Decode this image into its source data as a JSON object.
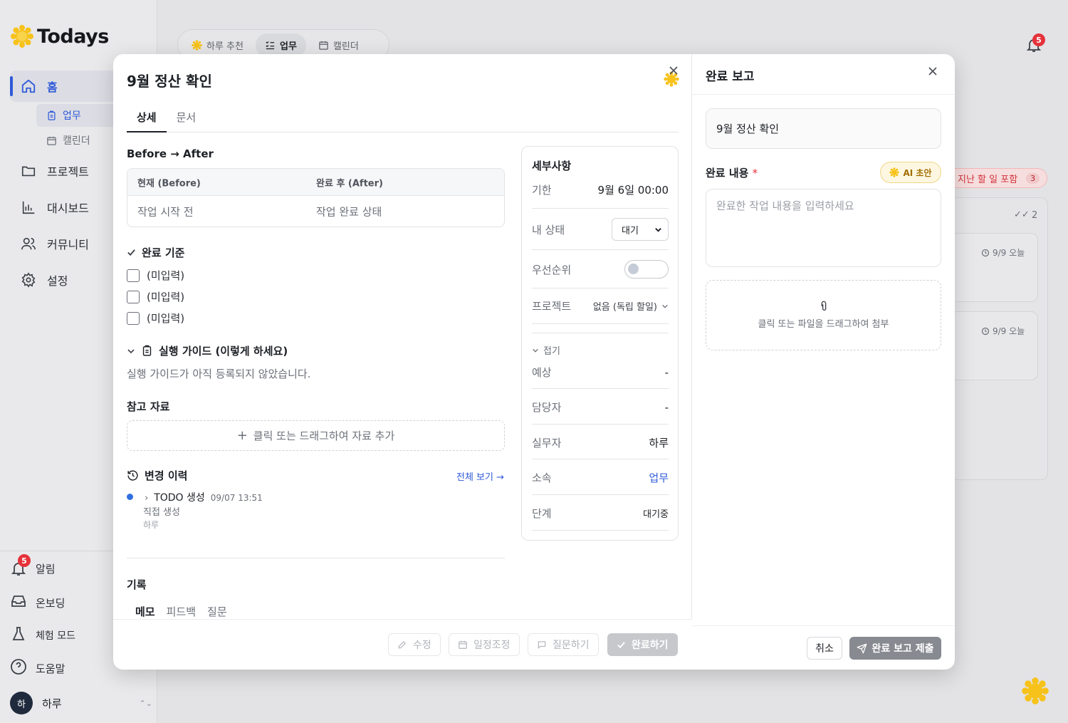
{
  "app": {
    "name": "Todays"
  },
  "sidebar": {
    "home": "홈",
    "sub": [
      "업무",
      "캘린더"
    ],
    "items": [
      "프로젝트",
      "대시보드",
      "커뮤니티",
      "설정"
    ],
    "bottom": [
      "알림",
      "온보딩",
      "체험 모드",
      "도움말"
    ],
    "alert_count": "5",
    "user_initial": "하",
    "user_name": "하루"
  },
  "topbar": {
    "tabs": [
      "하루 추천",
      "업무",
      "캘린더"
    ],
    "active_tab": "업무",
    "bell_count": "5"
  },
  "background": {
    "overdue_label": "지난 할 일 포함",
    "overdue_count": "3",
    "done_count": "2",
    "card_dates": [
      "9/9 오늘",
      "9/9 오늘"
    ]
  },
  "task": {
    "title": "9월 정산 확인",
    "tabs": [
      "상세",
      "문서"
    ],
    "before_after_title": "Before → After",
    "before_header": "현재 (Before)",
    "after_header": "완료 후 (After)",
    "before_value": "작업 시작 전",
    "after_value": "작업 완료 상태",
    "criteria_title": "완료 기준",
    "criteria": [
      "(미입력)",
      "(미입력)",
      "(미입력)"
    ],
    "guide_title": "실행 가이드 (이렇게 하세요)",
    "guide_empty": "실행 가이드가 아직 등록되지 않았습니다.",
    "reference_title": "참고 자료",
    "reference_drop": "클릭 또는 드래그하여 자료 추가",
    "history_title": "변경 이력",
    "history_view_all": "전체 보기 →",
    "history": {
      "action": "TODO 생성",
      "time": "09/07 13:51",
      "detail": "직접 생성",
      "actor": "하루"
    },
    "record_title": "기록",
    "record_tabs": [
      "메모",
      "피드백",
      "질문"
    ],
    "footer": {
      "edit": "수정",
      "reschedule": "일정조정",
      "ask": "질문하기",
      "complete": "완료하기"
    }
  },
  "details": {
    "title": "세부사항",
    "due_label": "기한",
    "due_value": "9월 6일 00:00",
    "status_label": "내 상태",
    "status_value": "대기",
    "priority_label": "우선순위",
    "priority_on": false,
    "project_label": "프로젝트",
    "project_value": "없음 (독립 할일)",
    "fold_label": "접기",
    "estimate_label": "예상",
    "estimate_value": "-",
    "owner_label": "담당자",
    "owner_value": "-",
    "worker_label": "실무자",
    "worker_value": "하루",
    "belong_label": "소속",
    "belong_value": "업무",
    "stage_label": "단계",
    "stage_value": "대기중"
  },
  "report": {
    "title": "완료 보고",
    "task_name": "9월 정산 확인",
    "content_label": "완료 내용",
    "required_mark": "*",
    "ai_button": "AI 초안",
    "placeholder": "완료한 작업 내용을 입력하세요",
    "attach_text": "클릭 또는 파일을 드래그하여 첨부",
    "cancel": "취소",
    "submit": "완료 보고 제출"
  },
  "colors": {
    "accent": "#2f5bd8",
    "brand_yellow": "#f7c21a",
    "danger": "#e5323b"
  }
}
